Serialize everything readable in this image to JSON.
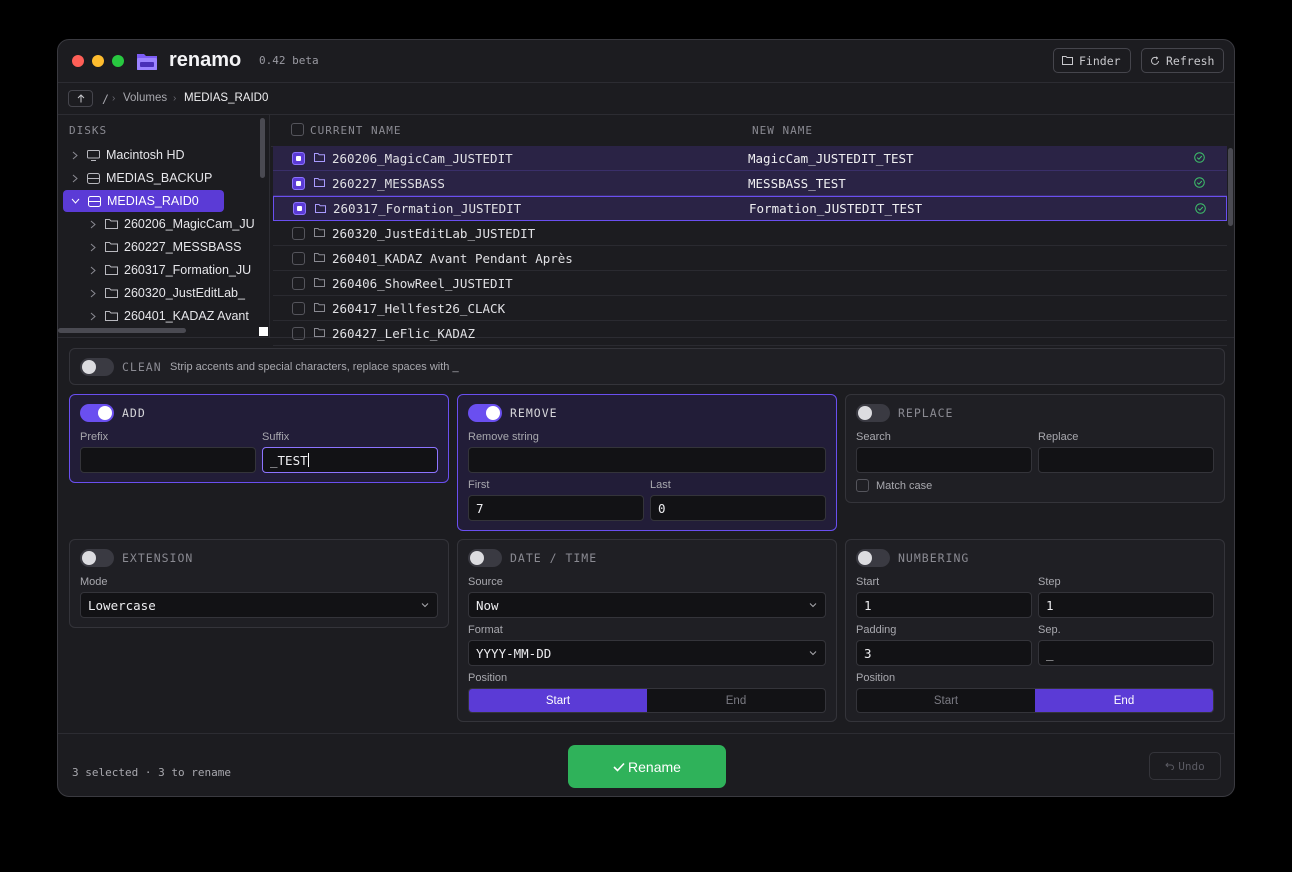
{
  "app": {
    "name": "renamo",
    "version": "0.42 beta"
  },
  "toolbar": {
    "finder_label": "Finder",
    "refresh_label": "Refresh"
  },
  "breadcrumb": {
    "root": "/",
    "items": [
      "Volumes",
      "MEDIAS_RAID0"
    ]
  },
  "sidebar": {
    "header": "DISKS",
    "disks": [
      {
        "label": "Macintosh HD",
        "icon": "computer-icon"
      },
      {
        "label": "MEDIAS_BACKUP",
        "icon": "drive-icon"
      },
      {
        "label": "MEDIAS_RAID0",
        "icon": "drive-icon",
        "selected": true
      }
    ],
    "children": [
      "260206_MagicCam_JU",
      "260227_MESSBASS",
      "260317_Formation_JU",
      "260320_JustEditLab_",
      "260401_KADAZ Avant"
    ]
  },
  "list": {
    "col_current": "CURRENT NAME",
    "col_new": "NEW NAME",
    "rows": [
      {
        "current": "260206_MagicCam_JUSTEDIT",
        "new": "MagicCam_JUSTEDIT_TEST",
        "checked": true
      },
      {
        "current": "260227_MESSBASS",
        "new": "MESSBASS_TEST",
        "checked": true
      },
      {
        "current": "260317_Formation_JUSTEDIT",
        "new": "Formation_JUSTEDIT_TEST",
        "checked": true
      },
      {
        "current": "260320_JustEditLab_JUSTEDIT",
        "new": "",
        "checked": false
      },
      {
        "current": "260401_KADAZ Avant Pendant Après",
        "new": "",
        "checked": false
      },
      {
        "current": "260406_ShowReel_JUSTEDIT",
        "new": "",
        "checked": false
      },
      {
        "current": "260417_Hellfest26_CLACK",
        "new": "",
        "checked": false
      },
      {
        "current": "260427_LeFlic_KADAZ",
        "new": "",
        "checked": false
      }
    ]
  },
  "clean": {
    "title": "CLEAN",
    "description": "Strip accents and special characters, replace spaces with _",
    "enabled": false
  },
  "add": {
    "title": "ADD",
    "enabled": true,
    "prefix_label": "Prefix",
    "prefix_value": "",
    "suffix_label": "Suffix",
    "suffix_value": "_TEST"
  },
  "remove": {
    "title": "REMOVE",
    "enabled": true,
    "string_label": "Remove string",
    "string_value": "",
    "first_label": "First",
    "first_value": "7",
    "last_label": "Last",
    "last_value": "0"
  },
  "replace": {
    "title": "REPLACE",
    "enabled": false,
    "search_label": "Search",
    "search_value": "",
    "replace_label": "Replace",
    "replace_value": "",
    "match_case_label": "Match case"
  },
  "extension": {
    "title": "EXTENSION",
    "enabled": false,
    "mode_label": "Mode",
    "mode_value": "Lowercase"
  },
  "datetime": {
    "title": "DATE / TIME",
    "enabled": false,
    "source_label": "Source",
    "source_value": "Now",
    "format_label": "Format",
    "format_value": "YYYY-MM-DD",
    "position_label": "Position",
    "pos_start": "Start",
    "pos_end": "End",
    "position": "Start"
  },
  "numbering": {
    "title": "NUMBERING",
    "enabled": false,
    "start_label": "Start",
    "start_value": "1",
    "step_label": "Step",
    "step_value": "1",
    "padding_label": "Padding",
    "padding_value": "3",
    "sep_label": "Sep.",
    "sep_value": "_",
    "position_label": "Position",
    "pos_start": "Start",
    "pos_end": "End",
    "position": "End"
  },
  "footer": {
    "status": "3 selected · 3 to rename",
    "rename_label": "Rename",
    "undo_label": "Undo"
  },
  "colors": {
    "accent": "#5b3bd6",
    "success": "#2fb25a"
  }
}
